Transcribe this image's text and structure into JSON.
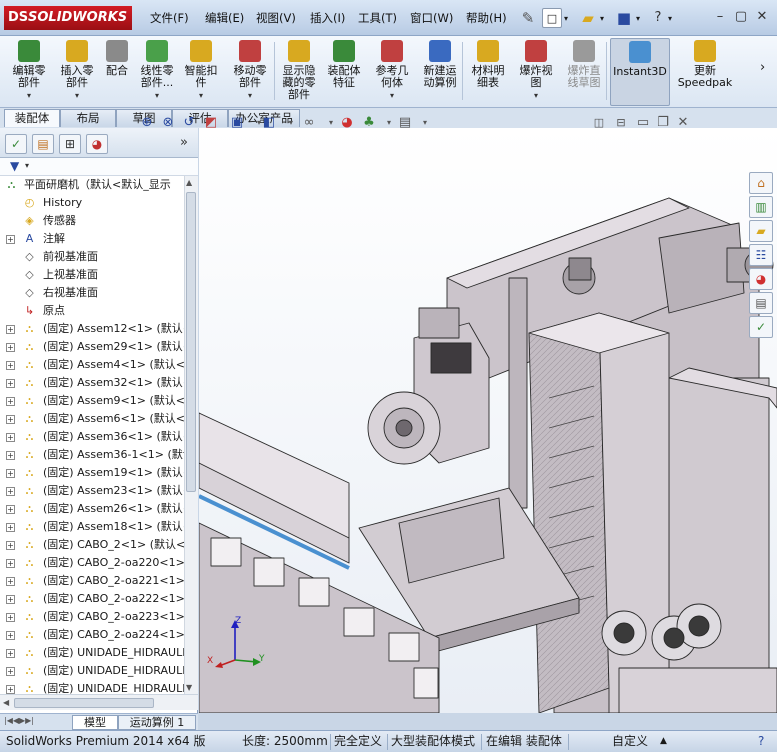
{
  "app": {
    "logo_text": "SOLIDWORKS",
    "logo_mark": "DS"
  },
  "menu": [
    "文件(F)",
    "编辑(E)",
    "视图(V)",
    "插入(I)",
    "工具(T)",
    "窗口(W)",
    "帮助(H)"
  ],
  "ribbon": [
    {
      "label": "编辑零\n部件",
      "icon": "edit-component-icon",
      "color": "#3a8a3a"
    },
    {
      "label": "插入零\n部件",
      "icon": "insert-component-icon",
      "color": "#d8a920"
    },
    {
      "label": "配合",
      "icon": "mate-icon",
      "color": "#8a8a8a"
    },
    {
      "label": "线性零\n部件...",
      "icon": "linear-pattern-icon",
      "color": "#4aa04a"
    },
    {
      "label": "智能扣\n件",
      "icon": "smart-fastener-icon",
      "color": "#d8a920"
    },
    {
      "label": "移动零\n部件",
      "icon": "move-component-icon",
      "color": "#c04040"
    },
    {
      "label": "显示隐\n藏的零\n部件",
      "icon": "show-hidden-icon",
      "color": "#d8a920"
    },
    {
      "label": "装配体\n特征",
      "icon": "assembly-feature-icon",
      "color": "#3a8a3a"
    },
    {
      "label": "参考几\n何体",
      "icon": "reference-geometry-icon",
      "color": "#c04040"
    },
    {
      "label": "新建运\n动算例",
      "icon": "motion-study-icon",
      "color": "#3a6ac0"
    },
    {
      "label": "材料明\n细表",
      "icon": "bom-icon",
      "color": "#d8a920"
    },
    {
      "label": "爆炸视\n图",
      "icon": "exploded-view-icon",
      "color": "#c04040"
    },
    {
      "label": "爆炸直\n线草图",
      "icon": "explode-line-sketch-icon",
      "color": "#9a9a9a"
    },
    {
      "label": "Instant3D",
      "icon": "instant3d-icon",
      "color": "#4a90d0"
    },
    {
      "label": "更新\nSpeedpak",
      "icon": "speedpak-icon",
      "color": "#d8a920"
    }
  ],
  "tabs": [
    "装配体",
    "布局",
    "草图",
    "评估",
    "办公室产品"
  ],
  "tree": {
    "root": "平面研磨机（默认<默认_显示",
    "items": [
      {
        "label": "History",
        "icon": "history-icon",
        "expand": false
      },
      {
        "label": "传感器",
        "icon": "sensor-icon",
        "expand": false
      },
      {
        "label": "注解",
        "icon": "annotation-icon",
        "expand": true
      },
      {
        "label": "前视基准面",
        "icon": "plane-icon",
        "expand": false
      },
      {
        "label": "上视基准面",
        "icon": "plane-icon",
        "expand": false
      },
      {
        "label": "右视基准面",
        "icon": "plane-icon",
        "expand": false
      },
      {
        "label": "原点",
        "icon": "origin-icon",
        "expand": false
      },
      {
        "label": "(固定) Assem12<1> (默认<",
        "icon": "subassembly-icon",
        "expand": true
      },
      {
        "label": "(固定) Assem29<1> (默认<",
        "icon": "subassembly-icon",
        "expand": true
      },
      {
        "label": "(固定) Assem4<1> (默认<默",
        "icon": "subassembly-icon",
        "expand": true
      },
      {
        "label": "(固定) Assem32<1> (默认<",
        "icon": "subassembly-icon",
        "expand": true
      },
      {
        "label": "(固定) Assem9<1> (默认<默",
        "icon": "subassembly-icon",
        "expand": true
      },
      {
        "label": "(固定) Assem6<1> (默认<默",
        "icon": "subassembly-icon",
        "expand": true
      },
      {
        "label": "(固定) Assem36<1> (默认<",
        "icon": "subassembly-icon",
        "expand": true
      },
      {
        "label": "(固定) Assem36-1<1> (默认",
        "icon": "subassembly-icon",
        "expand": true
      },
      {
        "label": "(固定) Assem19<1> (默认<",
        "icon": "subassembly-icon",
        "expand": true
      },
      {
        "label": "(固定) Assem23<1> (默认<",
        "icon": "subassembly-icon",
        "expand": true
      },
      {
        "label": "(固定) Assem26<1> (默认<",
        "icon": "subassembly-icon",
        "expand": true
      },
      {
        "label": "(固定) Assem18<1> (默认<",
        "icon": "subassembly-icon",
        "expand": true
      },
      {
        "label": "(固定) CABO_2<1> (默认<-",
        "icon": "subassembly-icon",
        "expand": true
      },
      {
        "label": "(固定) CABO_2-oa220<1> (",
        "icon": "subassembly-icon",
        "expand": true
      },
      {
        "label": "(固定) CABO_2-oa221<1> (",
        "icon": "subassembly-icon",
        "expand": true
      },
      {
        "label": "(固定) CABO_2-oa222<1> (",
        "icon": "subassembly-icon",
        "expand": true
      },
      {
        "label": "(固定) CABO_2-oa223<1> (",
        "icon": "subassembly-icon",
        "expand": true
      },
      {
        "label": "(固定) CABO_2-oa224<1> (",
        "icon": "subassembly-icon",
        "expand": true
      },
      {
        "label": "(固定) UNIDADE_HIDRAULIC",
        "icon": "subassembly-icon",
        "expand": true
      },
      {
        "label": "(固定) UNIDADE_HIDRAULIC",
        "icon": "subassembly-icon",
        "expand": true
      },
      {
        "label": "(固定) UNIDADE_HIDRAULIC",
        "icon": "subassembly-icon",
        "expand": true
      }
    ]
  },
  "bottom_tabs": [
    "模型",
    "运动算例 1"
  ],
  "status": {
    "product": "SolidWorks Premium 2014 x64 版",
    "length": "长度: 2500mm",
    "definition": "完全定义",
    "mode": "大型装配体模式",
    "editing": "在编辑 装配体",
    "units": "自定义"
  },
  "triad": {
    "x": "X",
    "y": "Y",
    "z": "Z"
  },
  "colors": {
    "brand_red": "#c8191f",
    "model_body": "#c9c2c9",
    "model_edge": "#2a2a2a",
    "accent_blue": "#4a90d0"
  }
}
